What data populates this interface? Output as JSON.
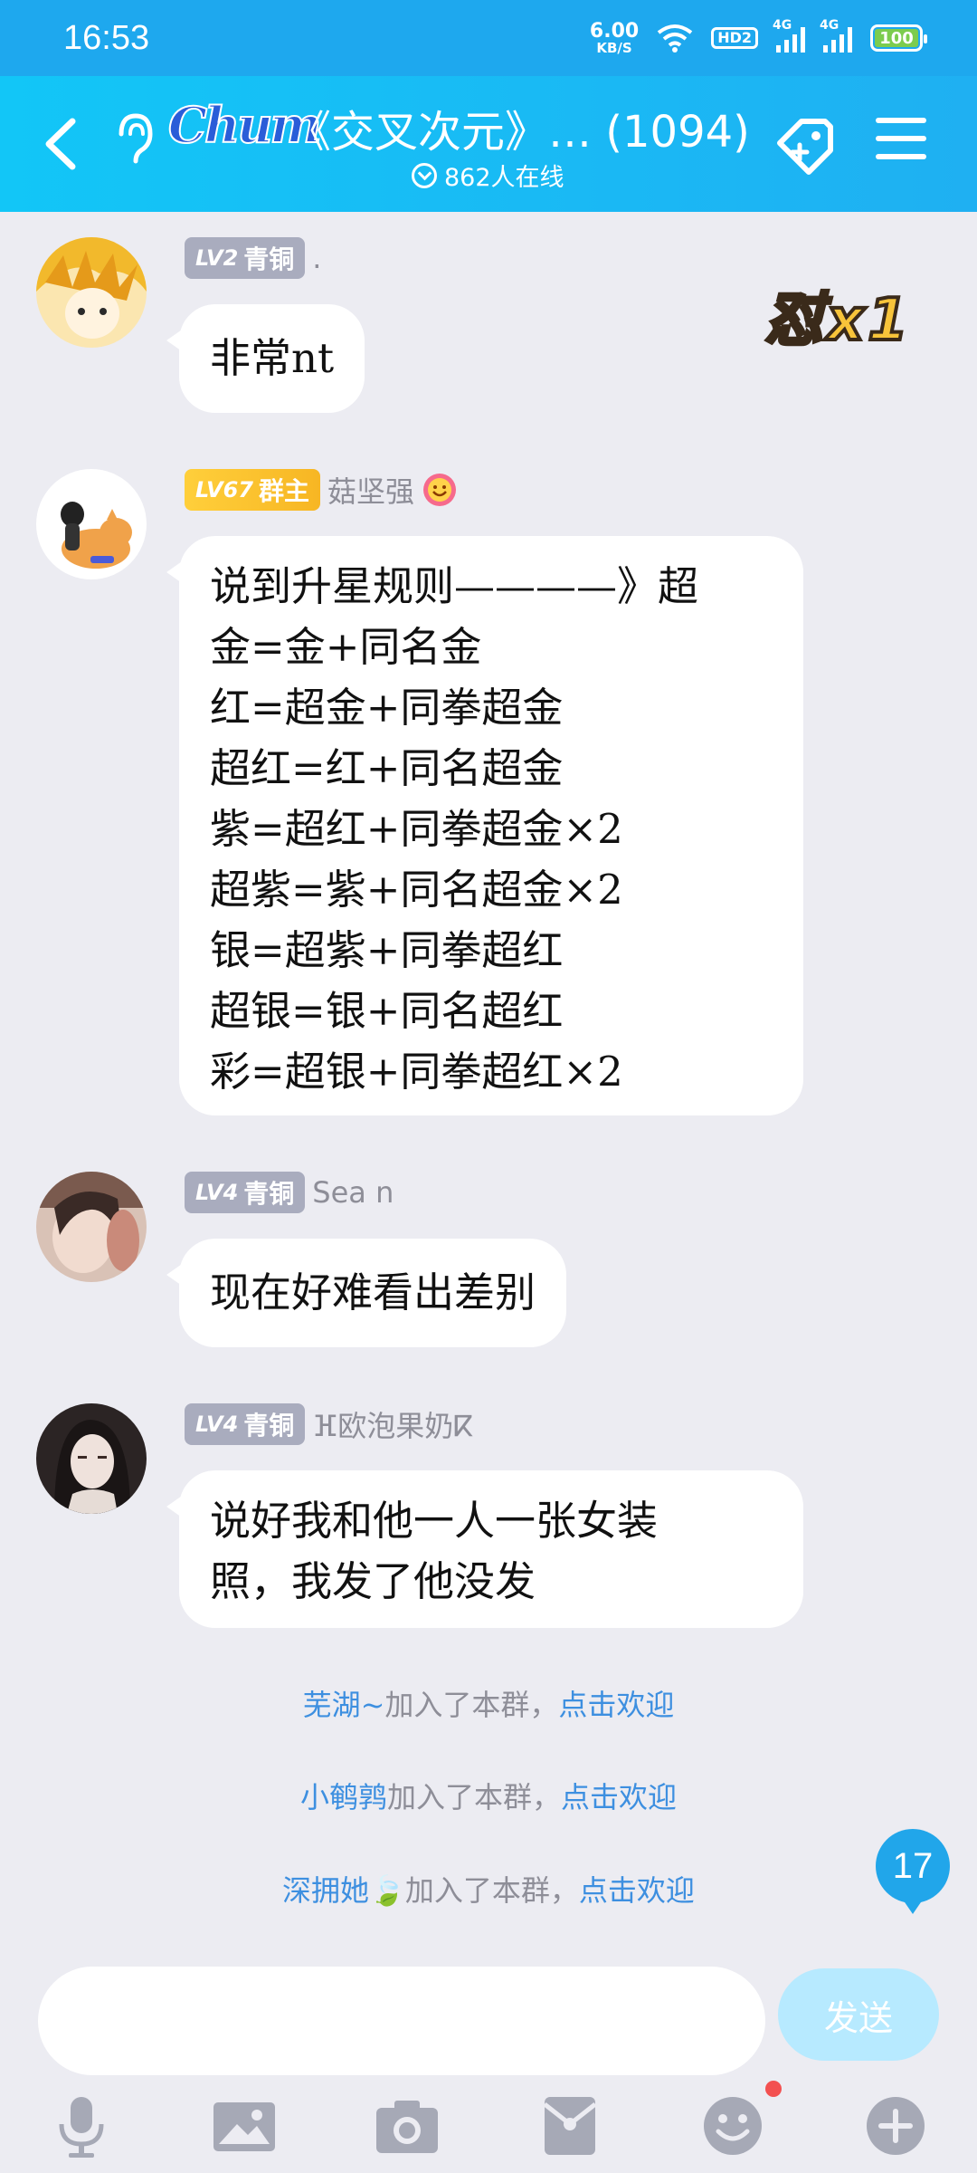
{
  "status_bar": {
    "time": "16:53",
    "net_speed": "6.00",
    "net_unit": "KB/S",
    "hd": "HD2",
    "sig1": "4G",
    "sig2": "4G",
    "battery": "100"
  },
  "header": {
    "logo": "Chum",
    "title": "《交叉次元》… (1094)",
    "online": "862人在线"
  },
  "messages": [
    {
      "level": "LV2",
      "rank": "青铜",
      "nick": ".",
      "text": "非常nt"
    },
    {
      "level": "LV67",
      "rank": "群主",
      "nick": "菇坚强",
      "text": "说到升星规则————》超\n金=金+同名金\n红=超金+同拳超金\n超红=红+同名超金\n紫=超红+同拳超金×2\n超紫=紫+同名超金×2\n银=超紫+同拳超红\n超银=银+同名超红\n彩=超银+同拳超红×2"
    },
    {
      "level": "LV4",
      "rank": "青铜",
      "nick": "Sea n",
      "text": "现在好难看出差别"
    },
    {
      "level": "LV4",
      "rank": "青铜",
      "nick": "ⴼ欧泡果奶ⴽ",
      "text": "说好我和他一人一张女装\n照，我发了他没发"
    }
  ],
  "sticker": "怼x1",
  "joins": [
    {
      "who": "芜湖~",
      "text": "加入了本群，",
      "action": "点击欢迎"
    },
    {
      "who": "小鹌鹑",
      "text": "加入了本群，",
      "action": "点击欢迎"
    },
    {
      "who": "深拥她🍃",
      "text": "加入了本群，",
      "action": "点击欢迎"
    }
  ],
  "unread_count": "17",
  "input": {
    "value": "",
    "send_label": "发送"
  },
  "toolbar_icons": [
    "microphone-icon",
    "image-icon",
    "camera-icon",
    "red-packet-icon",
    "emoji-icon",
    "plus-icon"
  ],
  "colors": {
    "header": "#1fb0f2",
    "status_bar": "#1ea8ee",
    "background": "#ececf2",
    "link": "#3d8fe0",
    "owner_badge": "#ffcf3b",
    "bronze_badge": "#a9acbe"
  }
}
